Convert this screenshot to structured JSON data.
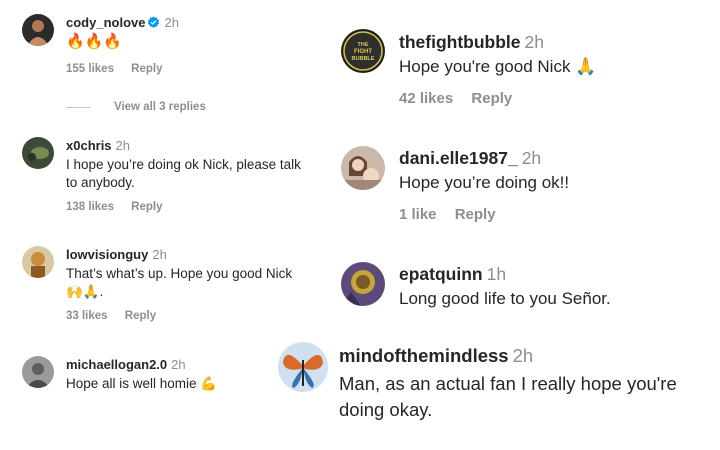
{
  "comments_left": [
    {
      "username": "cody_nolove",
      "time": "2h",
      "verified": true,
      "text": "🔥🔥🔥",
      "likes": "155 likes",
      "reply": "Reply",
      "view_replies": "View all 3 replies"
    },
    {
      "username": "x0chris",
      "time": "2h",
      "text": "I hope you’re doing ok Nick, please talk to anybody.",
      "likes": "138 likes",
      "reply": "Reply"
    },
    {
      "username": "lowvisionguy",
      "time": "2h",
      "text": "That’s what’s up. Hope you good Nick 🙌🙏.",
      "likes": "33 likes",
      "reply": "Reply"
    },
    {
      "username": "michaellogan2.0",
      "time": "2h",
      "text": "Hope all is well homie 💪"
    }
  ],
  "comments_right": [
    {
      "username": "thefightbubble",
      "time": "2h",
      "avatar_text": "THE FIGHT BUBBLE",
      "text": "Hope you're good Nick 🙏",
      "likes": "42 likes",
      "reply": "Reply"
    },
    {
      "username": "dani.elle1987_",
      "time": "2h",
      "text": "Hope you’re doing ok!!",
      "likes": "1 like",
      "reply": "Reply"
    },
    {
      "username": "epatquinn",
      "time": "1h",
      "text": "Long good life to you Señor."
    },
    {
      "username": "mindofthemindless",
      "time": "2h",
      "text": "Man, as an actual fan I really hope you're doing okay."
    }
  ],
  "colors": {
    "primary_text": "#262626",
    "secondary_text": "#8e8e8e",
    "verified_blue": "#0095f6"
  }
}
